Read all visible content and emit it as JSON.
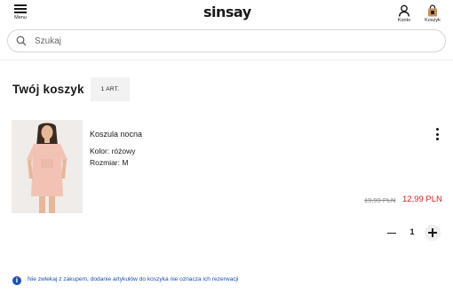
{
  "header": {
    "menu_label": "Menu",
    "logo_text": "sinsay",
    "account_label": "Konto",
    "cart_label": "Koszyk"
  },
  "search": {
    "placeholder": "Szukaj"
  },
  "cart": {
    "title": "Twój koszyk",
    "count_badge": "1 ART."
  },
  "product": {
    "name": "Koszula nocna",
    "color": "Kolor: różowy",
    "size": "Rozmiar: M",
    "price_old": "19,99 PLN",
    "price_new": "12,99 PLN",
    "quantity": "1"
  },
  "info": {
    "message": "Nie zwlekaj z zakupem, dodanie artykułów do koszyka nie oznacza ich rezerwacji"
  },
  "colors": {
    "sale_price": "#e02020",
    "info_blue": "#1c4fb5",
    "cart_icon_brown": "#c5935a"
  },
  "icons": {
    "menu": "hamburger-icon",
    "account": "user-icon",
    "cart": "shopping-bag-icon",
    "search": "search-icon",
    "more": "kebab-menu-icon",
    "info": "info-icon",
    "minus": "minus-icon",
    "plus": "plus-icon"
  }
}
